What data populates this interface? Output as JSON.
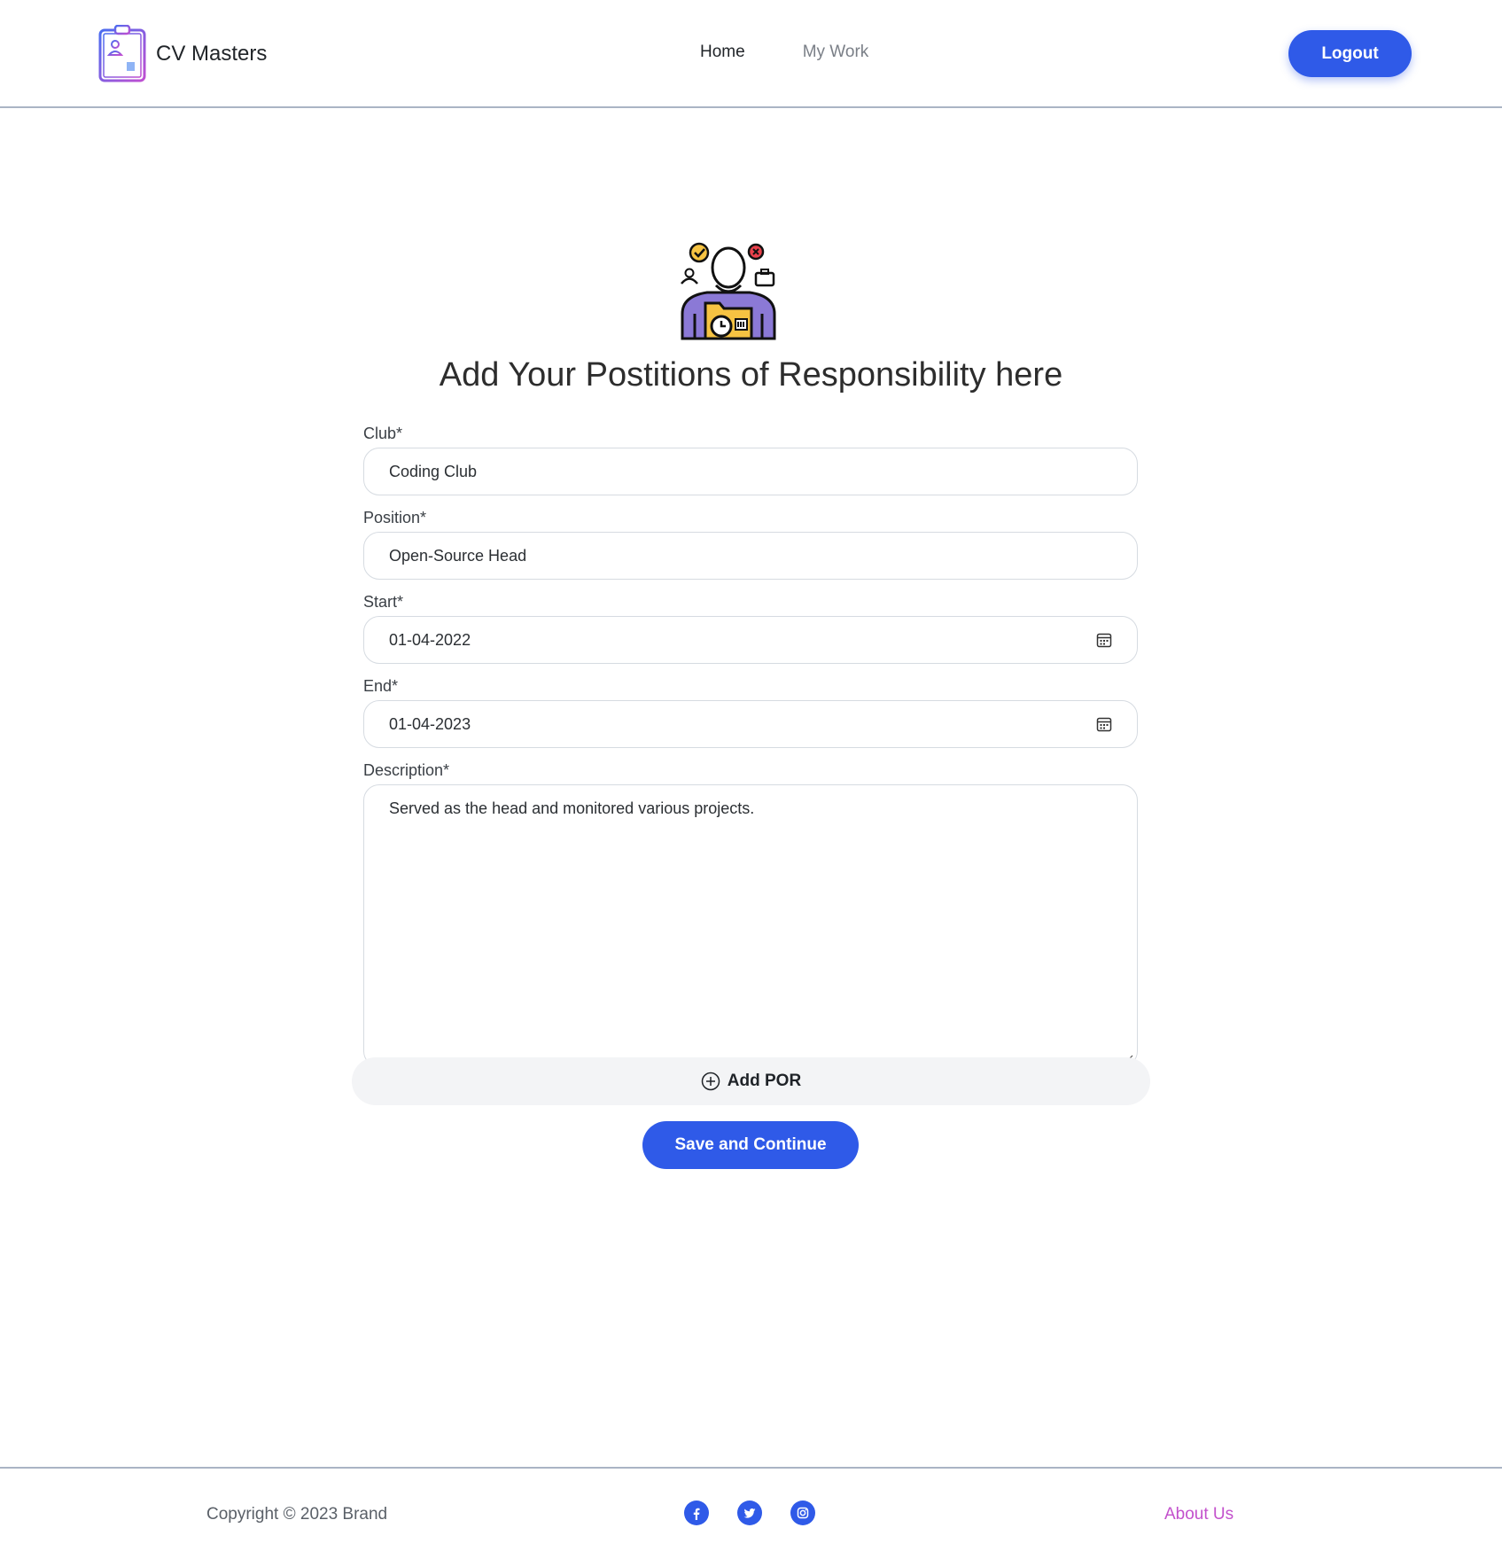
{
  "navbar": {
    "brand": "CV Masters",
    "links": [
      {
        "label": "Home",
        "active": true
      },
      {
        "label": "My Work",
        "active": false
      }
    ],
    "logout_label": "Logout"
  },
  "hero": {
    "title": "Add Your Postitions of Responsibility here"
  },
  "form": {
    "club": {
      "label": "Club*",
      "value": "Coding Club"
    },
    "position": {
      "label": "Position*",
      "value": "Open-Source Head"
    },
    "start": {
      "label": "Start*",
      "value": "01-04-2022"
    },
    "end": {
      "label": "End*",
      "value": "01-04-2023"
    },
    "description": {
      "label": "Description*",
      "value": "Served as the head and monitored various projects."
    }
  },
  "actions": {
    "add_label": "Add POR",
    "save_label": "Save and Continue"
  },
  "footer": {
    "copyright": "Copyright © 2023 Brand",
    "socials": [
      "facebook-icon",
      "twitter-icon",
      "instagram-icon"
    ],
    "about_label": "About Us"
  },
  "colors": {
    "primary": "#2f5ae8",
    "about_link": "#c351cc",
    "border": "#aab4c4"
  }
}
